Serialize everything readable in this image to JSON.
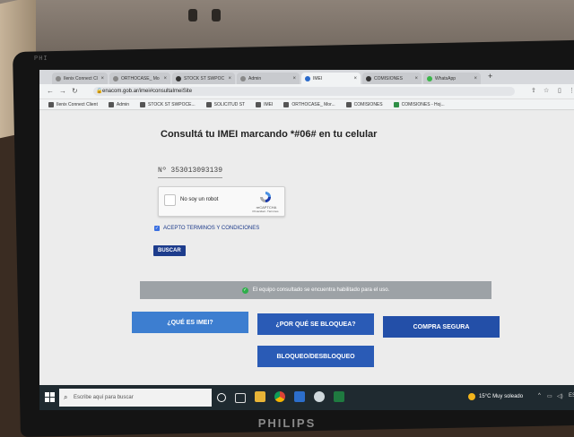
{
  "monitor": {
    "brand": "PHILIPS",
    "top_label": "PHI"
  },
  "browser": {
    "tabs": [
      {
        "label": "Ilenix Connect Cl"
      },
      {
        "label": "ORTHOCASE_ Mo"
      },
      {
        "label": "STOCK ST SWPOC"
      },
      {
        "label": "Admin"
      },
      {
        "label": "IMEI"
      },
      {
        "label": "COMISIONES"
      },
      {
        "label": "WhatsApp"
      }
    ],
    "new_tab": "+",
    "url": "enacom.gob.ar/imei#consultaImeiSite",
    "bookmarks": [
      {
        "label": "Ilenix Connect Client"
      },
      {
        "label": "Admin"
      },
      {
        "label": "STOCK ST SWPOCE..."
      },
      {
        "label": "SOLICITUD ST"
      },
      {
        "label": "IMEI"
      },
      {
        "label": "ORTHOCASE_ Mor..."
      },
      {
        "label": "COMISIONES"
      },
      {
        "label": "COMISIONES - Hoj..."
      }
    ]
  },
  "page": {
    "heading": "Consultá tu IMEI marcando *#06# en tu celular",
    "imei_value": "Nº 353013093139",
    "captcha": {
      "label": "No soy un robot",
      "brand": "reCAPTCHA",
      "links": "Privacidad - Términos"
    },
    "terms_label": "ACEPTO TERMINOS Y CONDICIONES",
    "search_button": "BUSCAR",
    "status_message": "El equipo consultado se encuentra habilitado para el uso.",
    "buttons": {
      "what_is_imei": "¿QUÉ ES IMEI?",
      "why_blocked": "¿POR QUÉ SE BLOQUEA?",
      "secure_purchase": "COMPRA SEGURA",
      "block_unblock": "BLOQUEO/DESBLOQUEO"
    }
  },
  "taskbar": {
    "search_placeholder": "Escribe aquí para buscar",
    "weather": "15°C  Muy soleado",
    "lang": "ES"
  }
}
